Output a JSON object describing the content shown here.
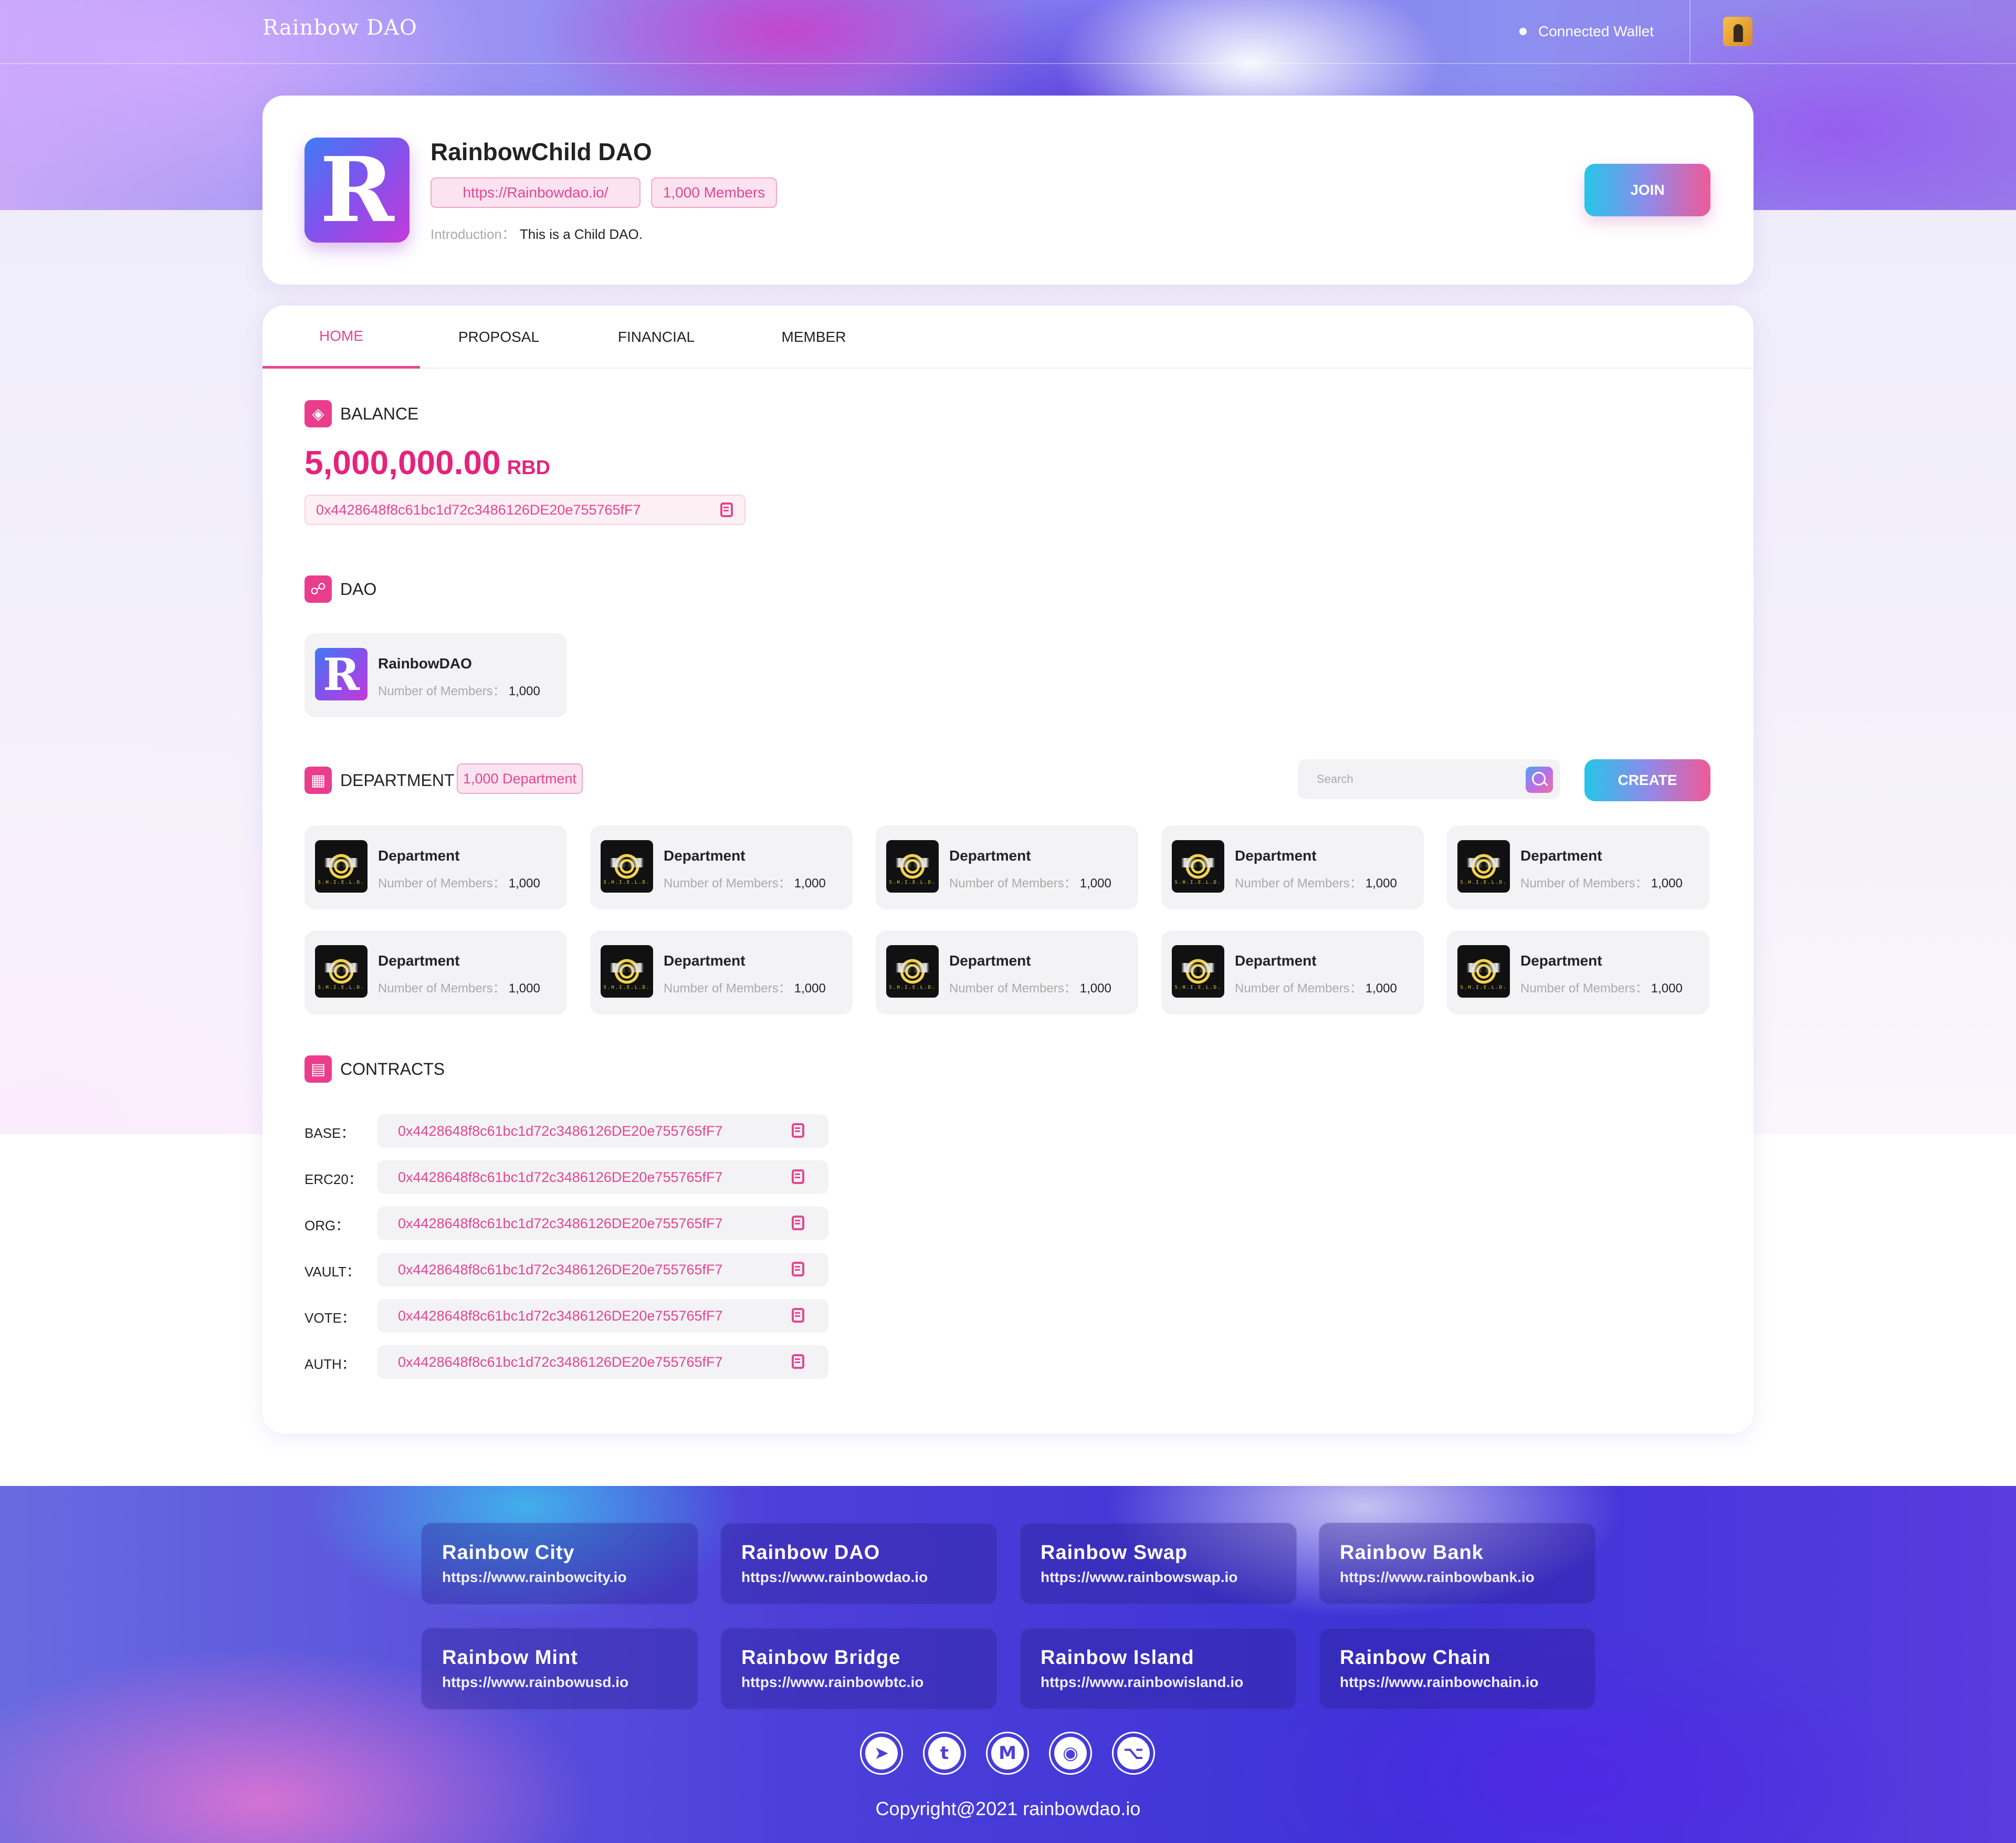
{
  "header": {
    "brand": "Rainbow DAO",
    "wallet_status": "Connected  Wallet"
  },
  "dao": {
    "name": "RainbowChild DAO",
    "logo_letter": "R",
    "url": "https://Rainbowdao.io/",
    "members": "1,000 Members",
    "intro_label": "Introduction：",
    "intro_text": "This is a Child DAO.",
    "join_label": "JOIN"
  },
  "tabs": [
    "HOME",
    "PROPOSAL",
    "FINANCIAL",
    "MEMBER"
  ],
  "active_tab": "HOME",
  "balance": {
    "title": "BALANCE",
    "amount": "5,000,000.00",
    "unit": "RBD",
    "address": "0x4428648f8c61bc1d72c3486126DE20e755765fF7"
  },
  "dao_section": {
    "title": "DAO",
    "item": {
      "logo_letter": "R",
      "name": "RainbowDAO",
      "members_label": "Number of Members：",
      "members": "1,000"
    }
  },
  "department": {
    "title": "DEPARTMENT",
    "count_label": "1,000 Department",
    "search_placeholder": "Search",
    "create_label": "CREATE",
    "shield_tag": "S.H.I.E.L.D.",
    "items": [
      {
        "name": "Department",
        "members_label": "Number of Members：",
        "members": "1,000"
      },
      {
        "name": "Department",
        "members_label": "Number of Members：",
        "members": "1,000"
      },
      {
        "name": "Department",
        "members_label": "Number of Members：",
        "members": "1,000"
      },
      {
        "name": "Department",
        "members_label": "Number of Members：",
        "members": "1,000"
      },
      {
        "name": "Department",
        "members_label": "Number of Members：",
        "members": "1,000"
      },
      {
        "name": "Department",
        "members_label": "Number of Members：",
        "members": "1,000"
      },
      {
        "name": "Department",
        "members_label": "Number of Members：",
        "members": "1,000"
      },
      {
        "name": "Department",
        "members_label": "Number of Members：",
        "members": "1,000"
      },
      {
        "name": "Department",
        "members_label": "Number of Members：",
        "members": "1,000"
      },
      {
        "name": "Department",
        "members_label": "Number of Members：",
        "members": "1,000"
      }
    ]
  },
  "contracts": {
    "title": "CONTRACTS",
    "items": [
      {
        "label": "BASE：",
        "address": "0x4428648f8c61bc1d72c3486126DE20e755765fF7"
      },
      {
        "label": "ERC20：",
        "address": "0x4428648f8c61bc1d72c3486126DE20e755765fF7"
      },
      {
        "label": "ORG：",
        "address": "0x4428648f8c61bc1d72c3486126DE20e755765fF7"
      },
      {
        "label": "VAULT：",
        "address": "0x4428648f8c61bc1d72c3486126DE20e755765fF7"
      },
      {
        "label": "VOTE：",
        "address": "0x4428648f8c61bc1d72c3486126DE20e755765fF7"
      },
      {
        "label": "AUTH：",
        "address": "0x4428648f8c61bc1d72c3486126DE20e755765fF7"
      }
    ]
  },
  "footer": {
    "links": [
      {
        "title": "Rainbow City",
        "url": "https://www.rainbowcity.io"
      },
      {
        "title": "Rainbow DAO",
        "url": "https://www.rainbowdao.io"
      },
      {
        "title": "Rainbow Swap",
        "url": "https://www.rainbowswap.io"
      },
      {
        "title": "Rainbow Bank",
        "url": "https://www.rainbowbank.io"
      },
      {
        "title": "Rainbow Mint",
        "url": "https://www.rainbowusd.io"
      },
      {
        "title": "Rainbow Bridge",
        "url": "https://www.rainbowbtc.io"
      },
      {
        "title": "Rainbow Island",
        "url": "https://www.rainbowisland.io"
      },
      {
        "title": "Rainbow Chain",
        "url": "https://www.rainbowchain.io"
      }
    ],
    "social": [
      {
        "icon": "telegram-icon",
        "glyph": "➤"
      },
      {
        "icon": "twitter-icon",
        "glyph": "t"
      },
      {
        "icon": "medium-icon",
        "glyph": "M"
      },
      {
        "icon": "discord-icon",
        "glyph": "◉"
      },
      {
        "icon": "github-icon",
        "glyph": "⌥"
      }
    ],
    "copyright": "Copyright@2021 rainbowdao.io"
  },
  "colors": {
    "accent": "#e64592",
    "brand_pink": "#e6237b",
    "footer_blue": "#4c3fd9"
  }
}
